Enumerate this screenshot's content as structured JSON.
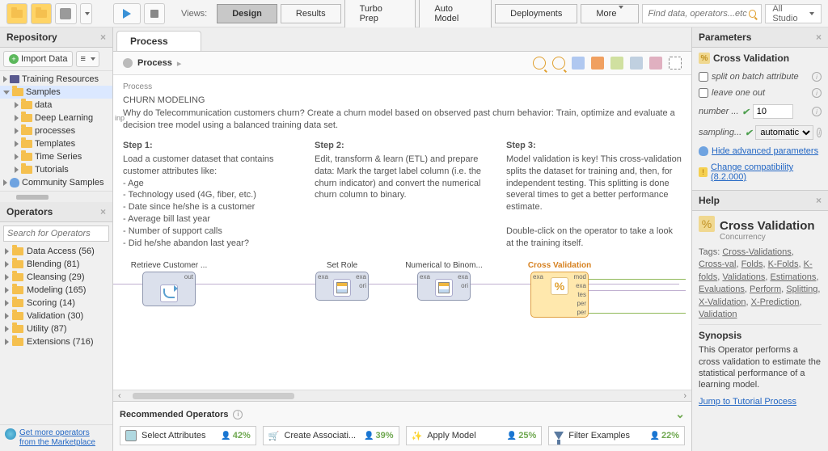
{
  "toolbar": {
    "views_label": "Views:",
    "tabs": [
      "Design",
      "Results",
      "Turbo Prep",
      "Auto Model",
      "Deployments",
      "More"
    ],
    "search_placeholder": "Find data, operators...etc",
    "studio": "All Studio"
  },
  "repository": {
    "title": "Repository",
    "import": "Import Data",
    "items": [
      "Training Resources",
      "Samples",
      "data",
      "Deep Learning",
      "processes",
      "Templates",
      "Time Series",
      "Tutorials",
      "Community Samples"
    ]
  },
  "operators": {
    "title": "Operators",
    "search_placeholder": "Search for Operators",
    "cats": [
      "Data Access (56)",
      "Blending (81)",
      "Cleansing (29)",
      "Modeling (165)",
      "Scoring (14)",
      "Validation (30)",
      "Utility (87)",
      "Extensions (716)"
    ],
    "market_link": "Get more operators from the Marketplace"
  },
  "process": {
    "tab": "Process",
    "path": "Process",
    "label": "Process",
    "inp": "inp",
    "title": "CHURN MODELING",
    "desc": "Why do Telecommunication customers churn? Create a churn model based on observed past churn behavior: Train, optimize and evaluate a decision tree model using a balanced training data set.",
    "steps": [
      {
        "h": "Step 1:",
        "b": "Load a customer dataset that contains customer attributes like:\n- Age\n- Technology used (4G, fiber, etc.)\n- Date since he/she is a customer\n- Average bill last year\n- Number of support calls\n- Did he/she abandon last year?"
      },
      {
        "h": "Step 2:",
        "b": "Edit, transform & learn (ETL) and prepare data: Mark the target label column (i.e. the churn indicator) and convert the numerical churn column to binary."
      },
      {
        "h": "Step 3:",
        "b": "Model validation is key! This cross-validation splits the dataset for training and, then, for independent testing. This splitting is done several times to get a better performance estimate.\n\nDouble-click on the operator to take a look at the training itself."
      }
    ],
    "ops": {
      "retrieve": "Retrieve Customer ...",
      "setrole": "Set Role",
      "numbin": "Numerical to Binom...",
      "crossval": "Cross Validation",
      "out": "out",
      "exa": "exa",
      "ori": "ori",
      "mod": "mod",
      "tes": "tes",
      "per": "per"
    }
  },
  "recommended": {
    "title": "Recommended Operators",
    "ops": [
      {
        "name": "Select Attributes",
        "pct": "42%"
      },
      {
        "name": "Create Associati...",
        "pct": "39%"
      },
      {
        "name": "Apply Model",
        "pct": "25%"
      },
      {
        "name": "Filter Examples",
        "pct": "22%"
      }
    ]
  },
  "parameters": {
    "title": "Parameters",
    "optitle": "Cross Validation",
    "split": "split on batch attribute",
    "leave": "leave one out",
    "number": "number ...",
    "number_val": "10",
    "sampling": "sampling...",
    "sampling_val": "automatic",
    "hide": "Hide advanced parameters",
    "compat": "Change compatibility (8.2.000)"
  },
  "help": {
    "title": "Help",
    "op": "Cross Validation",
    "sub": "Concurrency",
    "tags_label": "Tags:",
    "tags": [
      "Cross-Validations",
      "Cross-val",
      "Folds",
      "K-Folds",
      "K-folds",
      "Validations",
      "Estimations",
      "Evaluations",
      "Perform",
      "Splitting",
      "X-Validation",
      "X-Prediction",
      "Validation"
    ],
    "syn_h": "Synopsis",
    "syn": "This Operator performs a cross validation to estimate the statistical performance of a learning model.",
    "link": "Jump to Tutorial Process"
  }
}
